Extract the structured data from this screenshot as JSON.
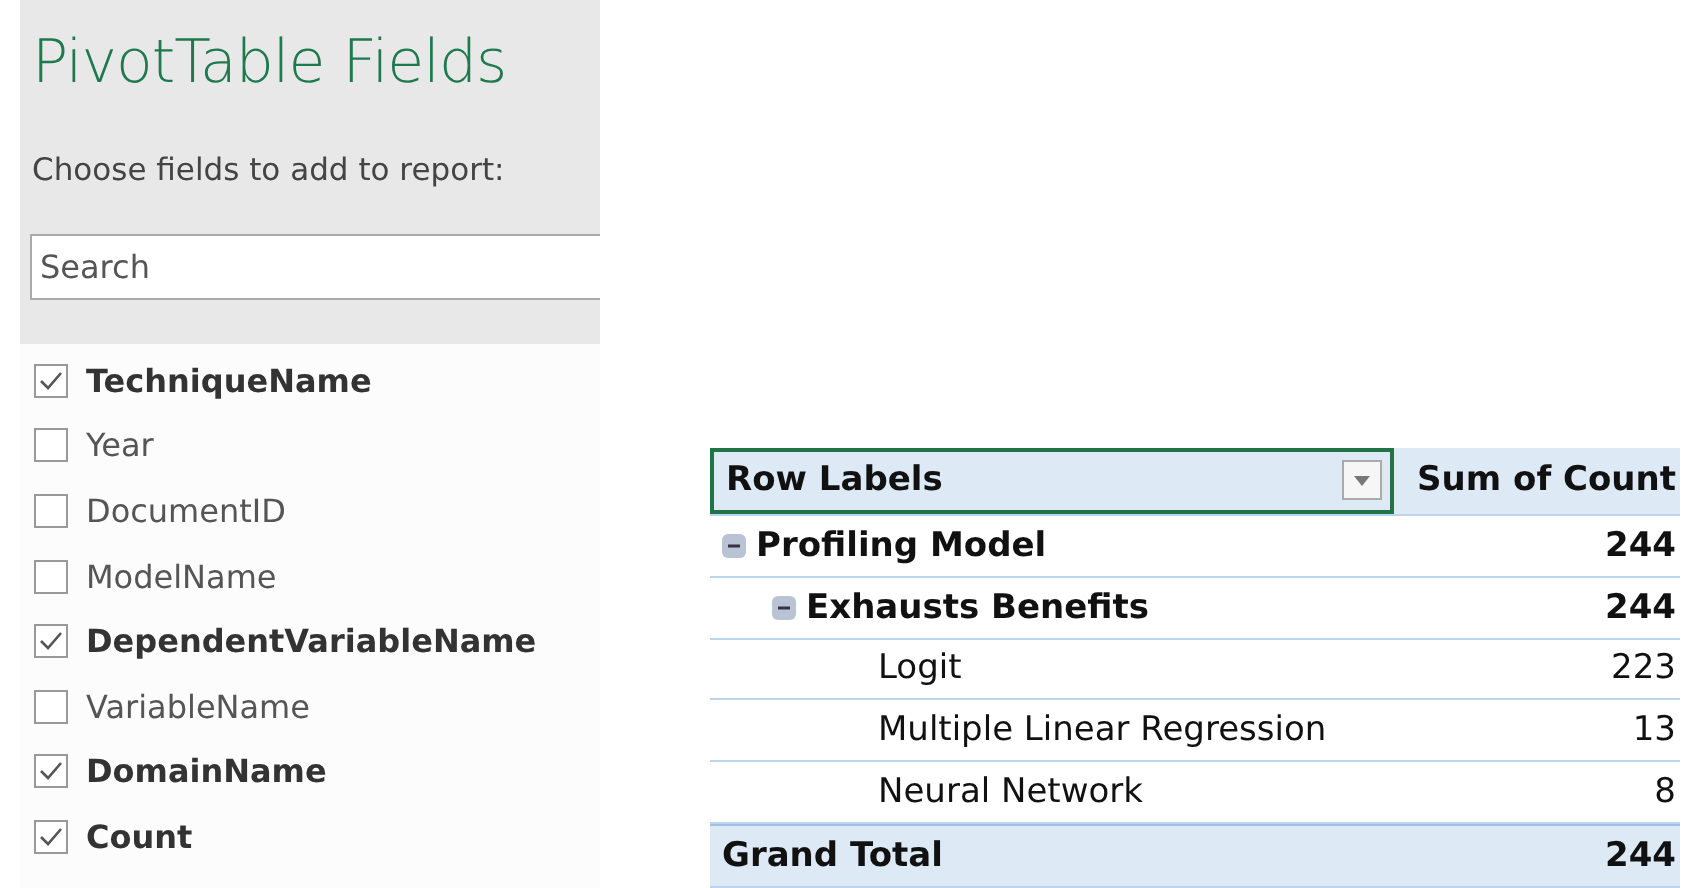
{
  "field_list": {
    "title": "PivotTable Fields",
    "subtitle": "Choose fields to add to report:",
    "search": {
      "placeholder": "Search"
    },
    "fields": [
      {
        "label": "TechniqueName",
        "checked": true
      },
      {
        "label": "Year",
        "checked": false
      },
      {
        "label": "DocumentID",
        "checked": false
      },
      {
        "label": "ModelName",
        "checked": false
      },
      {
        "label": "DependentVariableName",
        "checked": true
      },
      {
        "label": "VariableName",
        "checked": false
      },
      {
        "label": "DomainName",
        "checked": true
      },
      {
        "label": "Count",
        "checked": true
      }
    ]
  },
  "pivot_table": {
    "columns": [
      "Row Labels",
      "Sum of Count"
    ],
    "rows": [
      {
        "label": "Profiling Model",
        "value": "244",
        "expanded": true,
        "children": [
          {
            "label": "Exhausts Benefits",
            "value": "244",
            "expanded": true,
            "children": [
              {
                "label": "Logit",
                "value": "223"
              },
              {
                "label": "Multiple Linear Regression",
                "value": "13"
              },
              {
                "label": "Neural Network",
                "value": "8"
              }
            ]
          }
        ]
      }
    ],
    "grand_total": {
      "label": "Grand Total",
      "value": "244"
    }
  }
}
